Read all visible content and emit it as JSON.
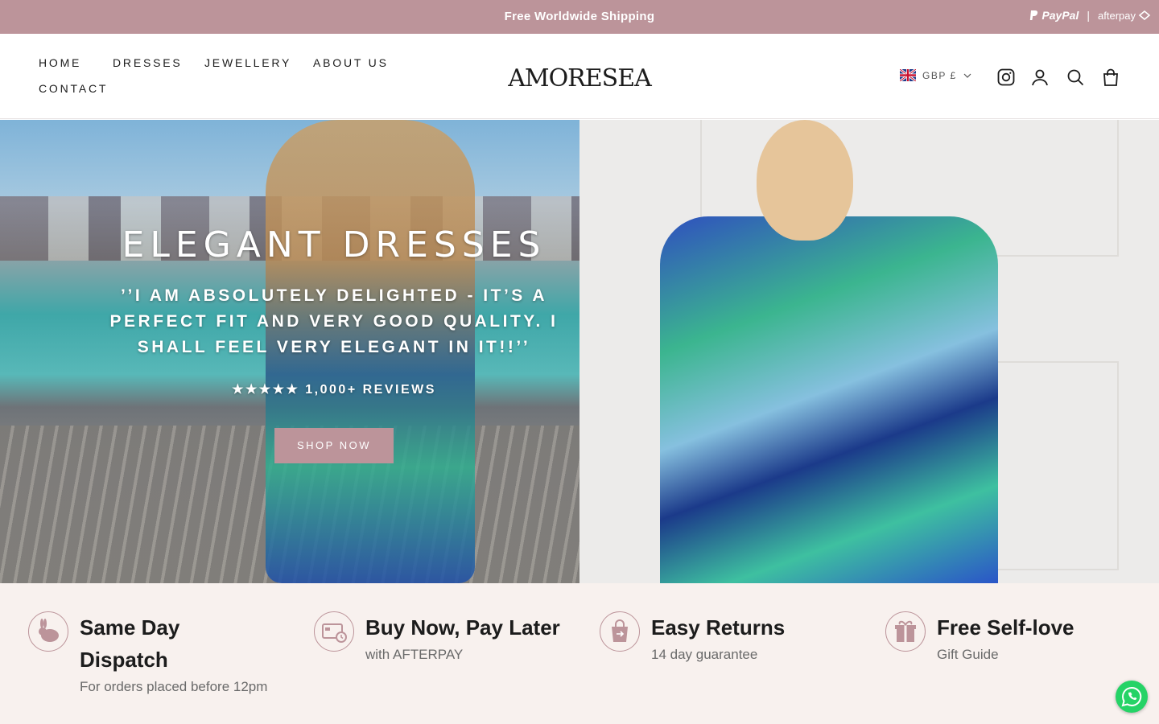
{
  "announcement": {
    "message": "Free Worldwide Shipping",
    "paypal": "PayPal",
    "separator": "|",
    "afterpay": "afterpay"
  },
  "header": {
    "nav": [
      "HOME",
      "DRESSES",
      "JEWELLERY",
      "ABOUT US",
      "CONTACT"
    ],
    "logo": "AMORESEA",
    "currency": "GBP £",
    "icons": [
      "instagram-icon",
      "account-icon",
      "search-icon",
      "cart-icon"
    ]
  },
  "hero": {
    "title": "ELEGANT DRESSES",
    "quote": "’’I AM ABSOLUTELY DELIGHTED - IT’S A PERFECT FIT AND VERY GOOD QUALITY. I SHALL FEEL VERY ELEGANT IN IT!!’’",
    "reviews": "★★★★★ 1,000+ REVIEWS",
    "button": "SHOP NOW"
  },
  "features": [
    {
      "title": "Same Day Dispatch",
      "subtitle": "For orders placed before 12pm",
      "icon": "rabbit-icon"
    },
    {
      "title": "Buy Now, Pay Later",
      "subtitle": "with AFTERPAY",
      "icon": "card-icon"
    },
    {
      "title": "Easy Returns",
      "subtitle": "14 day guarantee",
      "icon": "shopping-bag-icon"
    },
    {
      "title": "Free Self-love",
      "subtitle": "Gift Guide",
      "icon": "gift-icon"
    }
  ],
  "colors": {
    "accent": "#bc949a",
    "features_bg": "#f8f1ee",
    "whatsapp": "#25d366"
  }
}
